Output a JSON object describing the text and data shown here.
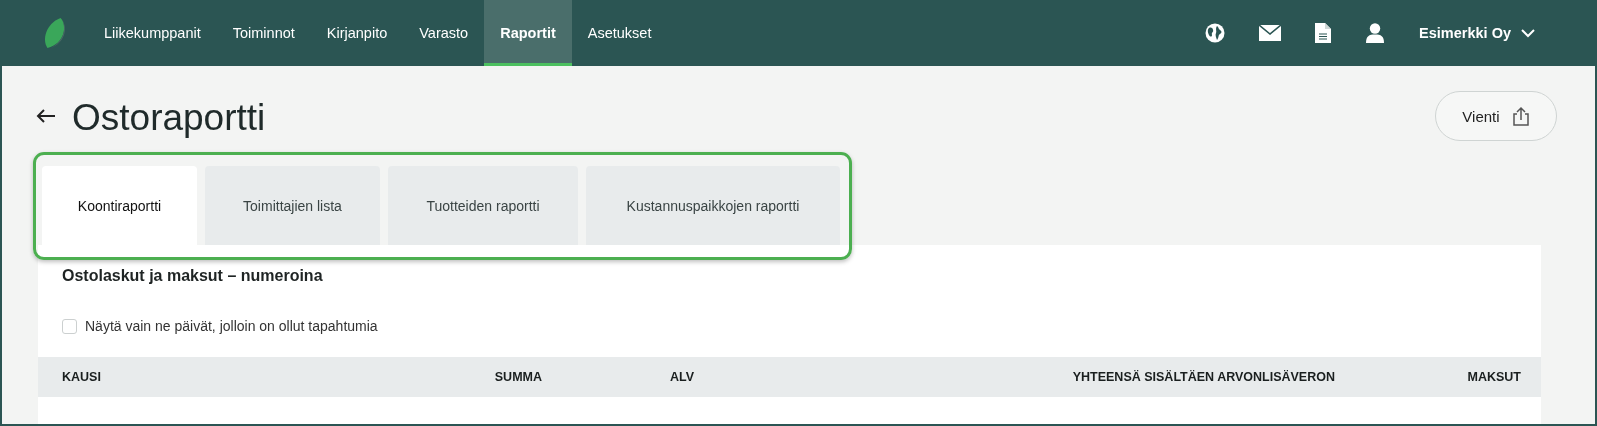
{
  "nav": {
    "items": [
      {
        "label": "Liikekumppanit",
        "selected": false
      },
      {
        "label": "Toiminnot",
        "selected": false
      },
      {
        "label": "Kirjanpito",
        "selected": false
      },
      {
        "label": "Varasto",
        "selected": false
      },
      {
        "label": "Raportit",
        "selected": true
      },
      {
        "label": "Asetukset",
        "selected": false
      }
    ],
    "company": "Esimerkki Oy"
  },
  "page": {
    "title": "Ostoraportti",
    "export_button": "Vienti"
  },
  "tabs": {
    "highlighted": true,
    "items": [
      {
        "label": "Koontiraportti",
        "selected": true
      },
      {
        "label": "Toimittajien lista",
        "selected": false
      },
      {
        "label": "Tuotteiden raportti",
        "selected": false
      },
      {
        "label": "Kustannuspaikkojen raportti",
        "selected": false
      }
    ]
  },
  "card": {
    "title": "Ostolaskut ja maksut – numeroina",
    "filter": {
      "label": "Näytä vain ne päivät, jolloin on ollut tapahtumia",
      "checked": false
    },
    "table": {
      "columns": [
        {
          "label": "KAUSI"
        },
        {
          "label": "SUMMA"
        },
        {
          "label": "ALV"
        },
        {
          "label": "YHTEENSÄ SISÄLTÄEN ARVONLISÄVERON"
        },
        {
          "label": "MAKSUT"
        }
      ]
    }
  }
}
